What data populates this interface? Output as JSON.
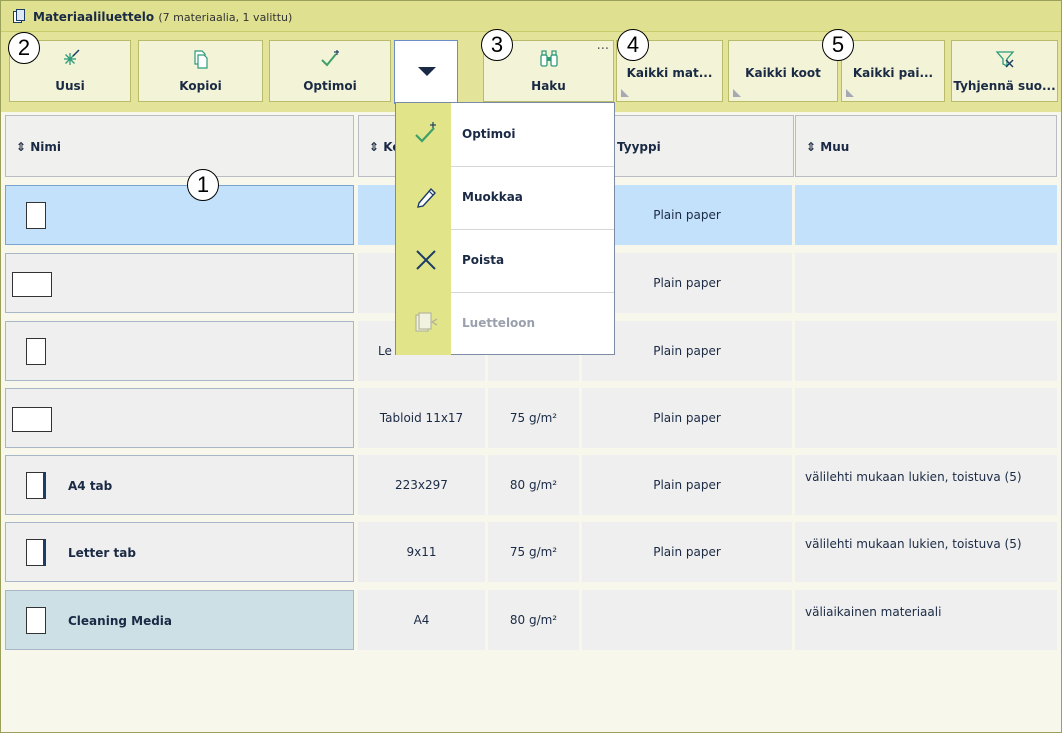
{
  "window": {
    "title": "Materiaaliluettelo",
    "subtitle": "(7 materiaalia, 1 valittu)"
  },
  "toolbar": {
    "new_label": "Uusi",
    "copy_label": "Kopioi",
    "optimize_label": "Optimoi",
    "search_label": "Haku",
    "filter_all_materials": "Kaikki mat...",
    "filter_all_sizes": "Kaikki koot",
    "filter_all_weights": "Kaikki pai...",
    "clear_filters": "Tyhjennä suo...",
    "more_glyph": "..."
  },
  "callouts": [
    "1",
    "2",
    "3",
    "4",
    "5"
  ],
  "table": {
    "headers": [
      "Nimi",
      "Ko",
      "Tyyppi",
      "Muu"
    ],
    "sort_glyph": "⇕",
    "rows": [
      {
        "name": "",
        "size": "",
        "weight": "",
        "type": "Plain paper",
        "other": "",
        "paper": "portrait"
      },
      {
        "name": "",
        "size": "",
        "weight": "",
        "type": "Plain paper",
        "other": "",
        "paper": "landscape"
      },
      {
        "name": "",
        "size": "Le",
        "weight": "",
        "type": "Plain paper",
        "other": "",
        "paper": "portrait"
      },
      {
        "name": "",
        "size": "Tabloid 11x17",
        "weight": "75 g/m²",
        "type": "Plain paper",
        "other": "",
        "paper": "landscape"
      },
      {
        "name": "A4 tab",
        "size": "223x297",
        "weight": "80 g/m²",
        "type": "Plain paper",
        "other": "välilehti mukaan lukien, toistuva (5)",
        "paper": "tab"
      },
      {
        "name": "Letter tab",
        "size": "9x11",
        "weight": "75 g/m²",
        "type": "Plain paper",
        "other": "välilehti mukaan lukien, toistuva (5)",
        "paper": "tab"
      },
      {
        "name": "Cleaning Media",
        "size": "A4",
        "weight": "80 g/m²",
        "type": "",
        "other": "väliaikainen materiaali",
        "paper": "portrait"
      }
    ]
  },
  "dropdown_menu": {
    "items": [
      {
        "label": "Optimoi",
        "icon": "check-wand-icon",
        "enabled": true
      },
      {
        "label": "Muokkaa",
        "icon": "pencil-icon",
        "enabled": true
      },
      {
        "label": "Poista",
        "icon": "cross-icon",
        "enabled": true
      },
      {
        "label": "Luetteloon",
        "icon": "add-to-list-icon",
        "enabled": false
      }
    ]
  },
  "colors": {
    "toolbar_bg": "#e3e49a",
    "selected_row": "#c4e1fb",
    "text_dark": "#1b2a44",
    "menu_icon_bg": "#e2e48a"
  }
}
